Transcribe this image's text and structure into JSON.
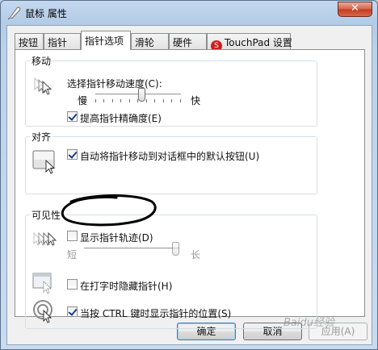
{
  "window": {
    "title": "鼠标 属性",
    "close_glyph": "✕"
  },
  "tabs": [
    {
      "label": "按钮"
    },
    {
      "label": "指针"
    },
    {
      "label": "指针选项",
      "active": true
    },
    {
      "label": "滑轮"
    },
    {
      "label": "硬件"
    },
    {
      "label": "TouchPad 设置",
      "logo_text": "S"
    }
  ],
  "motion": {
    "title": "移动",
    "speed_label": "选择指针移动速度(C):",
    "slow_label": "慢",
    "fast_label": "快",
    "speed_level": 0.55,
    "precision_label": "提高指针精确度(E)",
    "precision_checked": true
  },
  "snap": {
    "title": "对齐",
    "label": "自动将指针移动到对话框中的默认按钮(U)",
    "checked": true
  },
  "visibility": {
    "title": "可见性",
    "trails_label": "显示指针轨迹(D)",
    "trails_checked": false,
    "trails_short_label": "短",
    "trails_long_label": "长",
    "trails_level": 1.0,
    "hide_label": "在打字时隐藏指针(H)",
    "hide_checked": false,
    "ctrl_label": "当按 CTRL 键时显示指针的位置(S)",
    "ctrl_checked": true
  },
  "buttons": {
    "ok": "确定",
    "cancel": "取消",
    "apply": "应用(A)"
  },
  "watermark": "Baidu经验"
}
